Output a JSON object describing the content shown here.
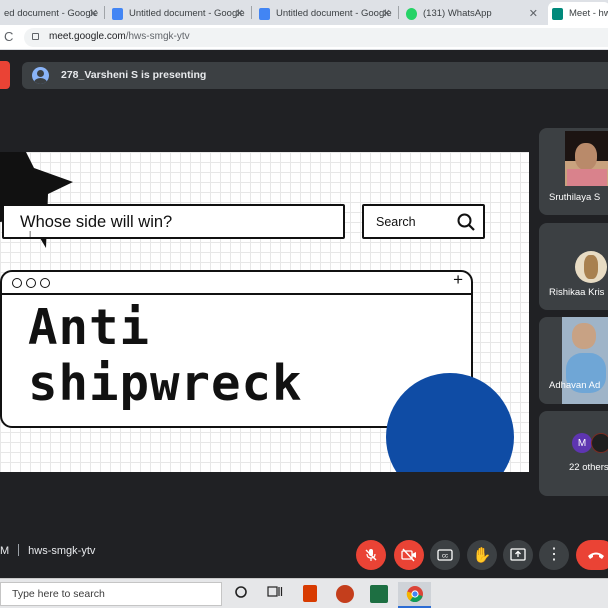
{
  "browser": {
    "tabs": [
      {
        "title": "ed document - Google",
        "favicon_color": "#4285f4"
      },
      {
        "title": "Untitled document - Google",
        "favicon_color": "#4285f4"
      },
      {
        "title": "Untitled document - Google",
        "favicon_color": "#4285f4"
      },
      {
        "title": "(131) WhatsApp",
        "favicon_color": "#25d366"
      },
      {
        "title": "Meet - hw",
        "favicon_color": "#00897b",
        "active": true
      }
    ],
    "url_host": "meet.google.com",
    "url_path": "/hws-smgk-ytv"
  },
  "meet": {
    "presenting_text": "278_Varsheni S is presenting",
    "slide": {
      "question": "Whose side will win?",
      "search_label": "Search",
      "title_line1": "Anti",
      "title_line2": "shipwreck",
      "circle_color": "#0f4ca5"
    },
    "participants": [
      {
        "name": "Sruthilaya S"
      },
      {
        "name": "Rishikaa Kris"
      },
      {
        "name": "Adhavan Ad"
      }
    ],
    "others": {
      "avatar_letter": "M",
      "label": "22 others"
    },
    "time_fragment": "M",
    "meeting_code": "hws-smgk-ytv",
    "accent_red": "#ea4335"
  },
  "taskbar": {
    "search_placeholder": "Type here to search",
    "icons": [
      "cortana-icon",
      "task-view-icon",
      "office-icon",
      "powerpoint-icon",
      "excel-icon",
      "chrome-icon"
    ]
  }
}
